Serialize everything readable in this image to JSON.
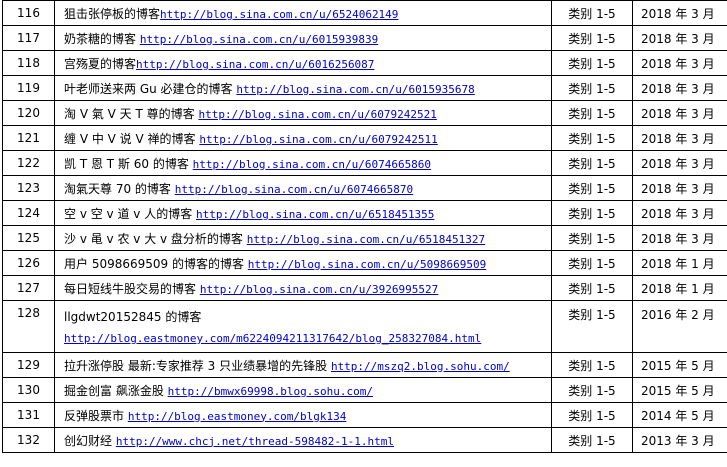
{
  "rows": [
    {
      "num": "116",
      "title": "狙击张停板的博客",
      "url": "http://blog.sina.com.cn/u/6524062149",
      "category": "类别 1-5",
      "date": "2018 年 3 月"
    },
    {
      "num": "117",
      "title": "奶茶糖的博客 ",
      "url": "http://blog.sina.com.cn/u/6015939839",
      "category": "类别 1-5",
      "date": "2018 年 3 月"
    },
    {
      "num": "118",
      "title": "宫殇夏的博客",
      "url": "http://blog.sina.com.cn/u/6016256087",
      "category": "类别 1-5",
      "date": "2018 年 3 月"
    },
    {
      "num": "119",
      "title": "叶老师送来两 Gu 必建仓的博客   ",
      "url": "http://blog.sina.com.cn/u/6015935678",
      "category": "类别 1-5",
      "date": "2018 年 3 月"
    },
    {
      "num": "120",
      "title": "淘 V 氣 V 天 T 尊的博客 ",
      "url": "http://blog.sina.com.cn/u/6079242521",
      "category": "类别 1-5",
      "date": "2018 年 3 月"
    },
    {
      "num": "121",
      "title": "缠 V 中 V 说 V 禅的博客 ",
      "url": "http://blog.sina.com.cn/u/6079242511",
      "category": "类别 1-5",
      "date": "2018 年 3 月"
    },
    {
      "num": "122",
      "title": "凯 T 恩 T 斯 60 的博客 ",
      "url": "http://blog.sina.com.cn/u/6074665860",
      "category": "类别 1-5",
      "date": "2018 年 3 月"
    },
    {
      "num": "123",
      "title": "淘氣天尊 70 的博客 ",
      "url": "http://blog.sina.com.cn/u/6074665870",
      "category": "类别 1-5",
      "date": "2018 年 3 月"
    },
    {
      "num": "124",
      "title": "空 v 空 v 道 v 人的博客 ",
      "url": "http://blog.sina.com.cn/u/6518451355",
      "category": "类别 1-5",
      "date": "2018 年 3 月"
    },
    {
      "num": "125",
      "title": "沙 v 黾 v 农 v 大 v 盘分析的博客 ",
      "url": "http://blog.sina.com.cn/u/6518451327",
      "category": "类别 1-5",
      "date": "2018 年 3 月"
    },
    {
      "num": "126",
      "title": "用户 5098669509 的博客的博客 ",
      "url": "http://blog.sina.com.cn/u/5098669509",
      "category": "类别 1-5",
      "date": "2018 年 1 月"
    },
    {
      "num": "127",
      "title": "每日短线牛股交易的博客 ",
      "url": "http://blog.sina.com.cn/u/3926995527",
      "category": "类别 1-5",
      "date": "2018 年 1 月"
    }
  ],
  "row128": {
    "num": "128",
    "title": "llgdwt20152845 的博客",
    "url": "http://blog.eastmoney.com/m6224094211317642/blog_258327084.html",
    "category": "类别 1-5",
    "date": "2016 年 2 月"
  },
  "rows2": [
    {
      "num": "129",
      "title": "拉升涨停股 最新:专家推荐 3 只业绩暴增的先锋股 ",
      "url": "http://mszq2.blog.sohu.com/",
      "category": "类别 1-5",
      "date": "2015 年 5 月"
    },
    {
      "num": "130",
      "title": "掘金创富 飙涨金股 ",
      "url": "http://bmwx69998.blog.sohu.com/",
      "category": "类别 1-5",
      "date": "2015 年 5 月"
    },
    {
      "num": "131",
      "title": "反弹股票市 ",
      "url": "http://blog.eastmoney.com/blgk134",
      "category": "类别 1-5",
      "date": "2014 年 5 月"
    },
    {
      "num": "132",
      "title": "创幻财经 ",
      "url": "http://www.chcj.net/thread-598482-1-1.html",
      "category": "类别 1-5",
      "date": "2013 年 3 月"
    }
  ]
}
